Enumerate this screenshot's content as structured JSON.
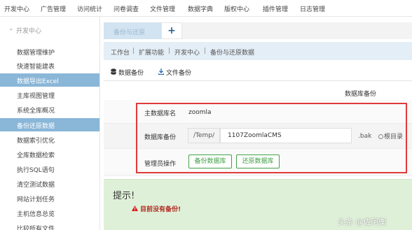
{
  "topbar": {
    "menus": [
      "开发中心",
      "广告管理",
      "访问统计",
      "问卷调查",
      "文件管理",
      "数据字典",
      "版权中心",
      "插件管理",
      "日志管理"
    ]
  },
  "sidebar": {
    "header": "开发中心",
    "items": [
      {
        "label": "数据管理维护",
        "active": false
      },
      {
        "label": "快速智能建表",
        "active": false
      },
      {
        "label": "数据导出Excel",
        "active": true
      },
      {
        "label": "主库视图管理",
        "active": false
      },
      {
        "label": "系统全库概况",
        "active": false
      },
      {
        "label": "备份还原数据",
        "active": true
      },
      {
        "label": "数据索引优化",
        "active": false
      },
      {
        "label": "全库数据检索",
        "active": false
      },
      {
        "label": "执行SQL语句",
        "active": false
      },
      {
        "label": "清空测试数据",
        "active": false
      },
      {
        "label": "网站计划任务",
        "active": false
      },
      {
        "label": "主机信息总览",
        "active": false
      },
      {
        "label": "比较所有文件",
        "active": false
      }
    ]
  },
  "tabs": {
    "active_label": "备份与还原",
    "add_label": "+"
  },
  "breadcrumb": [
    "工作台",
    "扩展功能",
    "开发中心",
    "备份与还原数据"
  ],
  "subtabs": {
    "db_backup": "数据备份",
    "file_backup": "文件备份"
  },
  "section": {
    "title": "数据库备份"
  },
  "form": {
    "main_db_label": "主数据库名",
    "main_db_value": "zoomla",
    "backup_label": "数据库备份",
    "path_prefix": "/Temp/",
    "path_value": "1107ZoomlaCMS",
    "path_suffix": ".bak",
    "root_dir_label": "根目录",
    "admin_label": "管理员操作",
    "backup_button": "备份数据库",
    "restore_button": "还原数据库"
  },
  "notice": {
    "title": "提示!",
    "message": "目前没有备份!"
  },
  "watermark": {
    "text": "头条 @佐阿衡"
  },
  "colors": {
    "sidebar_active": "#8ab6d8",
    "breadcrumb_bg": "#e4eef6",
    "highlight_border": "#e23a3a",
    "button_green": "#43a047",
    "notice_bg": "#dff0d8",
    "notice_text": "#b02a20"
  },
  "icons": {
    "db_tab": "database-icon",
    "file_tab": "download-icon",
    "warning": "warning-icon",
    "chevron": "chevron-down-icon"
  }
}
